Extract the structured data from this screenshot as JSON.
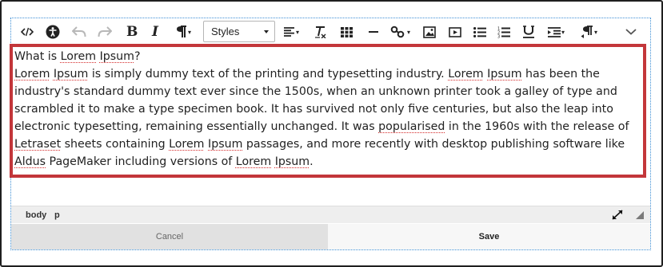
{
  "toolbar": {
    "styles_value": "Styles",
    "bold_label": "B",
    "italic_label": "I"
  },
  "content": {
    "lines": [
      [
        {
          "t": "What is "
        },
        {
          "t": "Lorem",
          "s": true
        },
        {
          "t": " "
        },
        {
          "t": "Ipsum",
          "s": true
        },
        {
          "t": "?"
        }
      ],
      [
        {
          "t": "Lorem",
          "s": true
        },
        {
          "t": " "
        },
        {
          "t": "Ipsum",
          "s": true
        },
        {
          "t": " is simply dummy text of the printing and typesetting industry. "
        },
        {
          "t": "Lorem",
          "s": true
        },
        {
          "t": " "
        },
        {
          "t": "Ipsum",
          "s": true
        },
        {
          "t": " has been the industry's standard dummy text ever since the 1500s, when an unknown printer took a galley of type and scrambled it to make a type specimen book. It has survived not only five centuries, but also the leap into electronic typesetting, remaining essentially unchanged. It was "
        },
        {
          "t": "popularised",
          "s": true
        },
        {
          "t": " in the 1960s with the release of "
        },
        {
          "t": "Letraset",
          "s": true
        },
        {
          "t": " sheets containing "
        },
        {
          "t": "Lorem",
          "s": true
        },
        {
          "t": " "
        },
        {
          "t": "Ipsum",
          "s": true
        },
        {
          "t": " passages, and more recently with desktop publishing software like "
        },
        {
          "t": "Aldus",
          "s": true
        },
        {
          "t": " PageMaker including versions of "
        },
        {
          "t": "Lorem",
          "s": true
        },
        {
          "t": " "
        },
        {
          "t": "Ipsum",
          "s": true
        },
        {
          "t": "."
        }
      ]
    ]
  },
  "statusbar": {
    "path": [
      "body",
      "p"
    ]
  },
  "footer": {
    "cancel_label": "Cancel",
    "save_label": "Save"
  },
  "colors": {
    "highlight_border": "#c3363a",
    "editor_border": "#3d8fd6",
    "spellcheck_underline": "#d42a2a"
  }
}
